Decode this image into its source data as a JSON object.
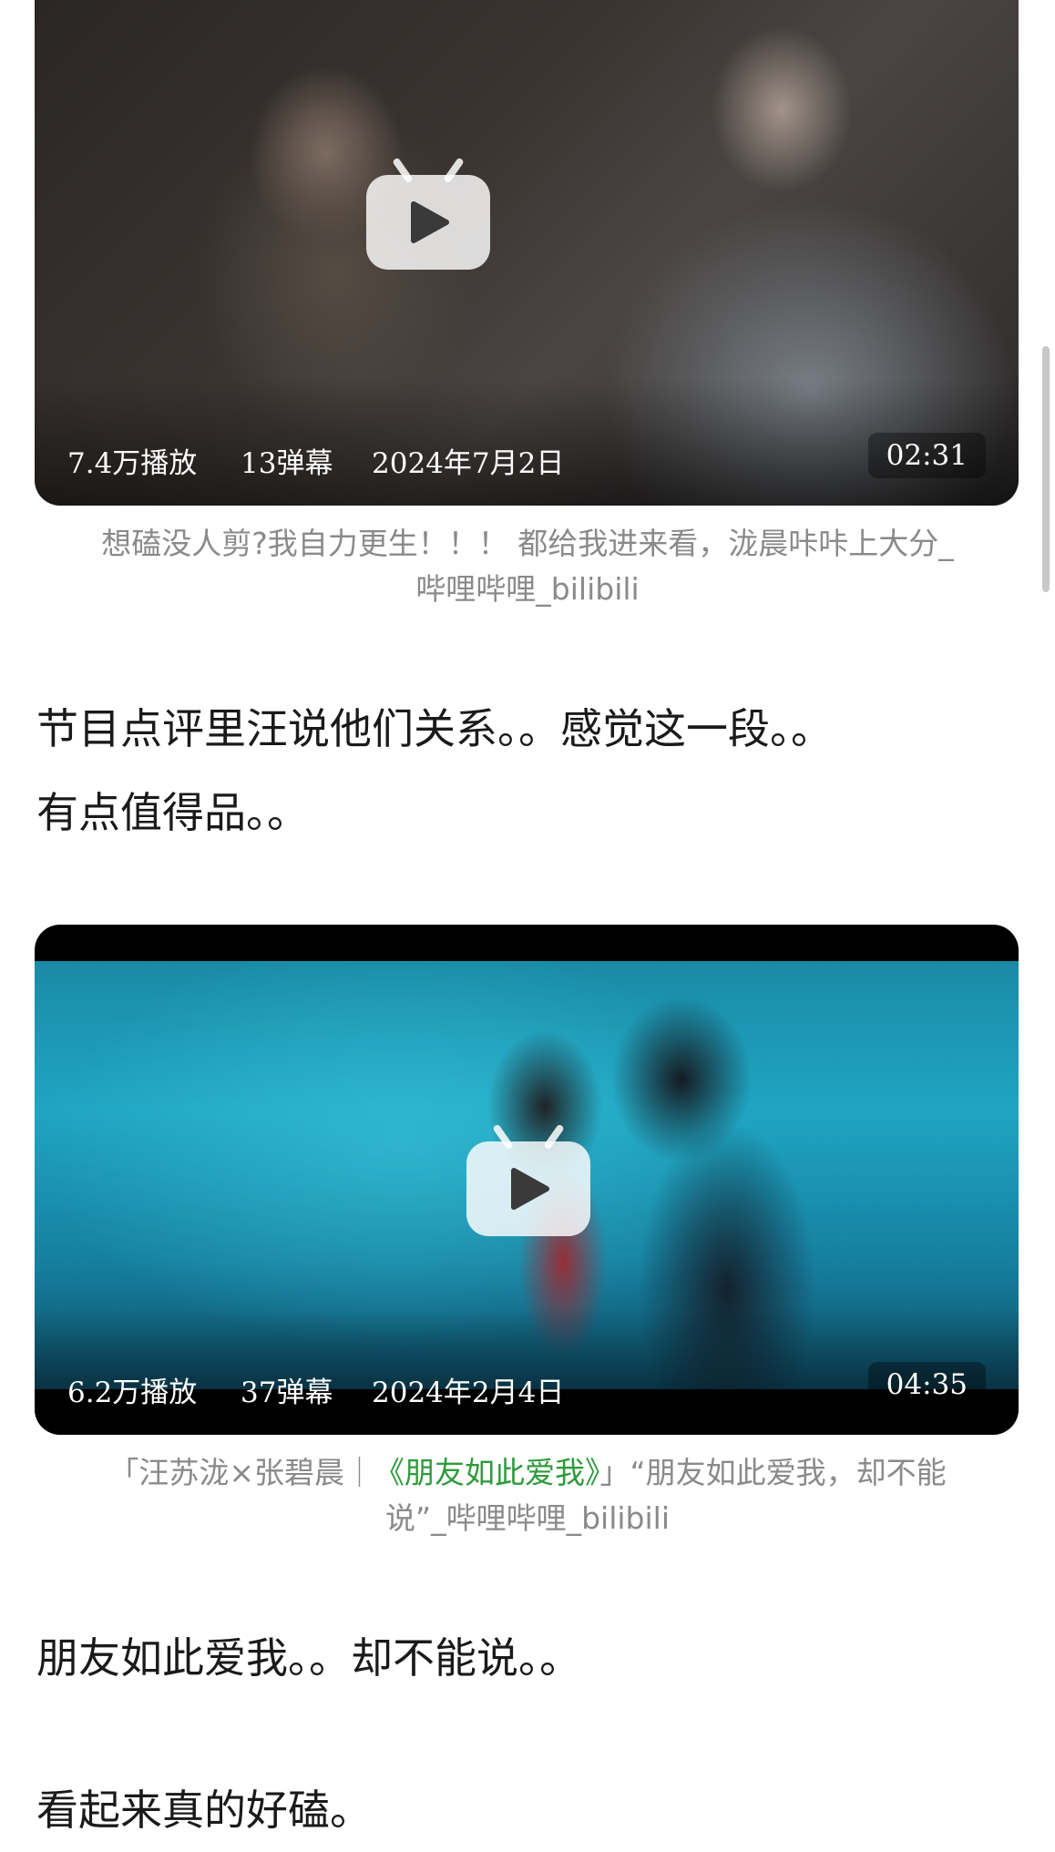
{
  "video1": {
    "views": "7.4万播放",
    "danmaku": "13弹幕",
    "date": "2024年7月2日",
    "duration": "02:31",
    "caption_line1": "想磕没人剪?我自力更生！！！ 都给我进来看，泷晨咔咔上大分_",
    "caption_line2": "哔哩哔哩_bilibili"
  },
  "paragraph1": {
    "line1": "节目点评里汪说他们关系。。感觉这一段。。",
    "line2": "有点值得品。。"
  },
  "video2": {
    "views": "6.2万播放",
    "danmaku": "37弹幕",
    "date": "2024年2月4日",
    "duration": "04:35",
    "caption_prefix": "「汪苏泷×张碧晨｜",
    "caption_green": "《朋友如此爱我》",
    "caption_suffix": "」“朋友如此爱我，却不能",
    "caption_line2": "说”_哔哩哔哩_bilibili"
  },
  "paragraph2": {
    "line1": "朋友如此爱我。。却不能说。。"
  },
  "paragraph3": {
    "line1": "看起来真的好磕。"
  },
  "colors": {
    "caption_gray": "#8a8a8a",
    "link_green": "#2f9a3c",
    "body_text": "#1a1a1a"
  }
}
